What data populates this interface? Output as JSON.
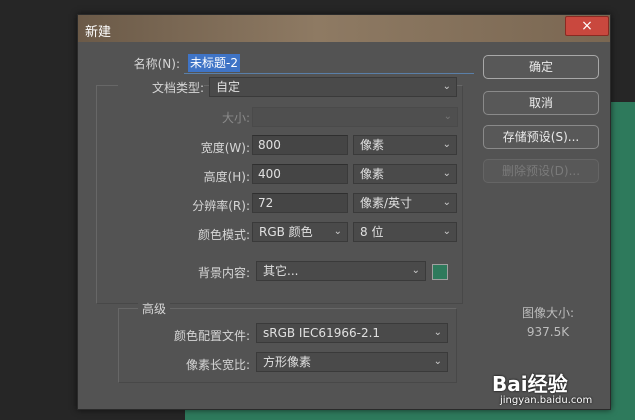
{
  "dialog": {
    "title": "新建",
    "close_icon": "×"
  },
  "form": {
    "name_label": "名称(N):",
    "name_value": "未标题-2",
    "doc_type_label": "文档类型:",
    "doc_type_value": "自定",
    "size_label": "大小:",
    "size_value": "",
    "width_label": "宽度(W):",
    "width_value": "800",
    "width_unit": "像素",
    "height_label": "高度(H):",
    "height_value": "400",
    "height_unit": "像素",
    "resolution_label": "分辨率(R):",
    "resolution_value": "72",
    "resolution_unit": "像素/英寸",
    "color_mode_label": "颜色模式:",
    "color_mode_value": "RGB 颜色",
    "bit_depth_value": "8 位",
    "bg_label": "背景内容:",
    "bg_value": "其它...",
    "bg_swatch_color": "#2e7a5c"
  },
  "advanced": {
    "heading": "高级",
    "color_profile_label": "颜色配置文件:",
    "color_profile_value": "sRGB IEC61966-2.1",
    "pixel_aspect_label": "像素长宽比:",
    "pixel_aspect_value": "方形像素"
  },
  "buttons": {
    "ok": "确定",
    "cancel": "取消",
    "save_preset": "存储预设(S)...",
    "delete_preset": "删除预设(D)..."
  },
  "image_size": {
    "label": "图像大小:",
    "value": "937.5K"
  },
  "watermark": {
    "brand": "Bai经验",
    "url": "jingyan.baidu.com"
  }
}
